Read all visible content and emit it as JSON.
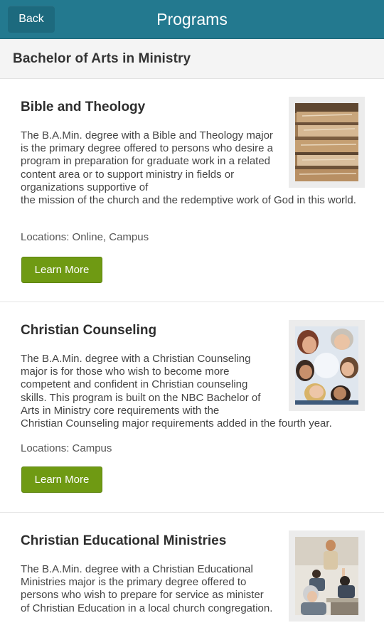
{
  "header": {
    "back_label": "Back",
    "title": "Programs"
  },
  "section": {
    "title": "Bachelor of Arts in Ministry"
  },
  "programs": [
    {
      "title": "Bible and Theology",
      "desc_narrow": "The B.A.Min. degree with a Bible and Theology major is the primary degree offered to persons who desire a program in preparation for graduate work in a related content area or to support ministry in fields or organizations supportive of",
      "desc_wide": "the mission of the church and the redemptive work of God in this world.",
      "locations": "Locations: Online, Campus",
      "button": "Learn More",
      "image": "stacked-books-photo"
    },
    {
      "title": "Christian Counseling",
      "desc_narrow": "The B.A.Min. degree with a Christian Counseling major is for those who wish to become more competent and confident in Christian counseling skills. This program is built on the NBC Bachelor of Arts in Ministry core requirements with the",
      "desc_wide": "Christian Counseling major requirements added in the fourth year.",
      "locations": "Locations: Campus",
      "button": "Learn More",
      "image": "group-huddle-photo"
    },
    {
      "title": "Christian Educational Ministries",
      "desc_narrow": "The B.A.Min. degree with a Christian Educational Ministries major is the primary degree offered to persons who wish to prepare for service as minister of Christian Education in a local church congregation.",
      "desc_wide": "",
      "locations": "",
      "button": "",
      "image": "classroom-photo"
    }
  ]
}
